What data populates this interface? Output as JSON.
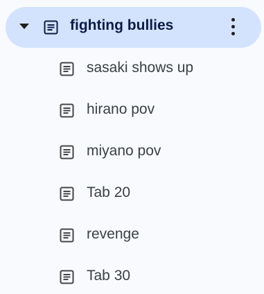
{
  "parent": {
    "label": "fighting bullies",
    "icon": "document-icon",
    "caret_icon": "caret-down-icon",
    "menu_icon": "more-vert-icon",
    "highlight_color": "#d3e3fd"
  },
  "children": [
    {
      "label": "sasaki shows up",
      "icon": "document-icon"
    },
    {
      "label": "hirano pov",
      "icon": "document-icon"
    },
    {
      "label": "miyano pov",
      "icon": "document-icon"
    },
    {
      "label": "Tab 20",
      "icon": "document-icon"
    },
    {
      "label": "revenge",
      "icon": "document-icon"
    },
    {
      "label": "Tab 30",
      "icon": "document-icon"
    }
  ]
}
